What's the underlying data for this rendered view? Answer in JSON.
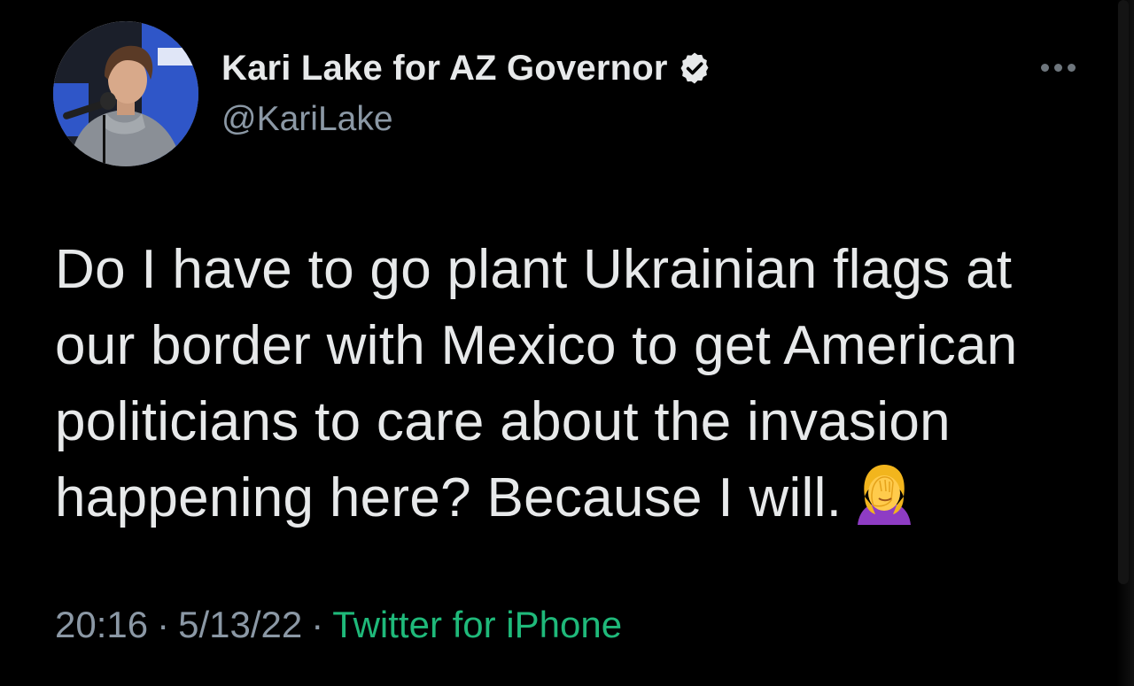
{
  "author": {
    "display_name": "Kari Lake for AZ Governor",
    "handle": "@KariLake",
    "verified": true,
    "avatar_icon": "profile-photo"
  },
  "tweet": {
    "lines": [
      "Do I have to go plant Ukrainian flags at",
      "our border with Mexico to get American",
      "politicians to care about the invasion",
      "happening here? Because I will."
    ],
    "emoji": "facepalm-woman-emoji"
  },
  "meta": {
    "time": "20:16",
    "separator": "·",
    "date": "5/13/22",
    "source": "Twitter for iPhone"
  },
  "colors": {
    "background": "#000000",
    "text": "#e7e9ea",
    "secondary": "#8b98a5",
    "source_link": "#1fb97a"
  },
  "menu": {
    "more_icon": "more-horizontal-icon"
  }
}
